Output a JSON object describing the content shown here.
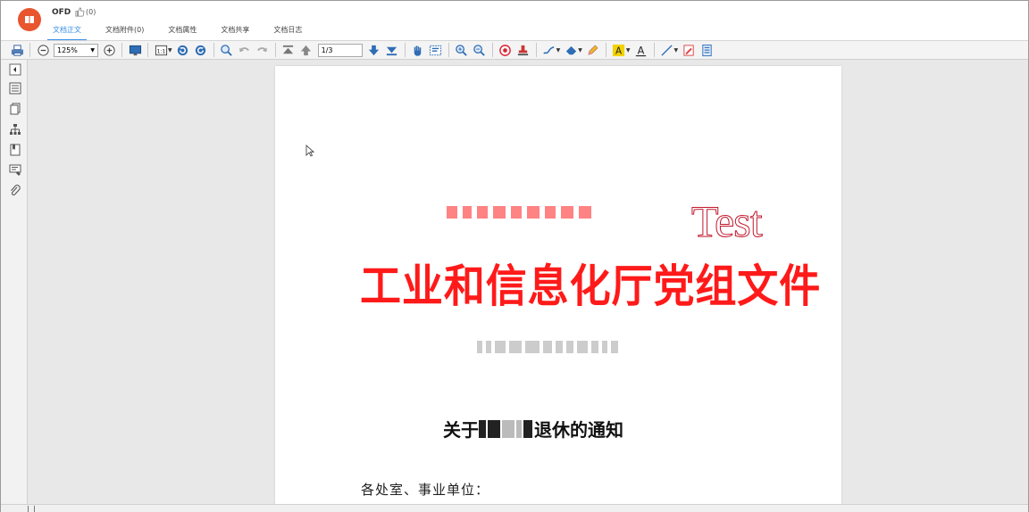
{
  "app": {
    "title": "OFD",
    "like_count": "(0)"
  },
  "tabs": [
    {
      "label": "文档正文",
      "active": true
    },
    {
      "label": "文档附件(0)",
      "active": false
    },
    {
      "label": "文档属性",
      "active": false
    },
    {
      "label": "文档共享",
      "active": false
    },
    {
      "label": "文档日志",
      "active": false
    }
  ],
  "toolbar": {
    "zoom": "125%",
    "fit_label": "1:1",
    "page": "1/3"
  },
  "document": {
    "watermark": "Test",
    "title": "工业和信息化厅党组文件",
    "notice_prefix": "关于",
    "notice_suffix": "退休的通知",
    "salutation": "各处室、事业单位："
  },
  "colors": {
    "accent": "#3a8ee6",
    "title_red": "#ff1a1a",
    "logo": "#e8552e"
  }
}
